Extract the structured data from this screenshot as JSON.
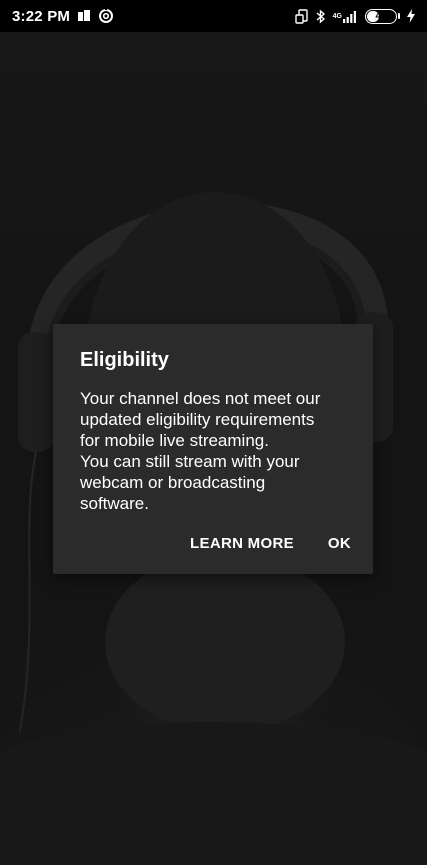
{
  "status_bar": {
    "time": "3:22 PM",
    "network_type": "4G",
    "battery_level": "47",
    "battery_fraction": 0.47,
    "icons": [
      "notification-icon",
      "data-saver-icon",
      "rotate-icon",
      "bluetooth-icon",
      "signal-icon",
      "battery-icon",
      "charging-icon"
    ]
  },
  "dialog": {
    "title": "Eligibility",
    "message_lines": [
      "Your channel does not meet our",
      "updated eligibility requirements",
      "for mobile live streaming.",
      "You can still stream with your",
      "webcam or broadcasting",
      "software."
    ],
    "buttons": {
      "learn_more": "LEARN MORE",
      "ok": "OK"
    }
  },
  "colors": {
    "dialog_background": "#2b2b2b",
    "status_bar": "#000000",
    "text": "#ffffff"
  }
}
